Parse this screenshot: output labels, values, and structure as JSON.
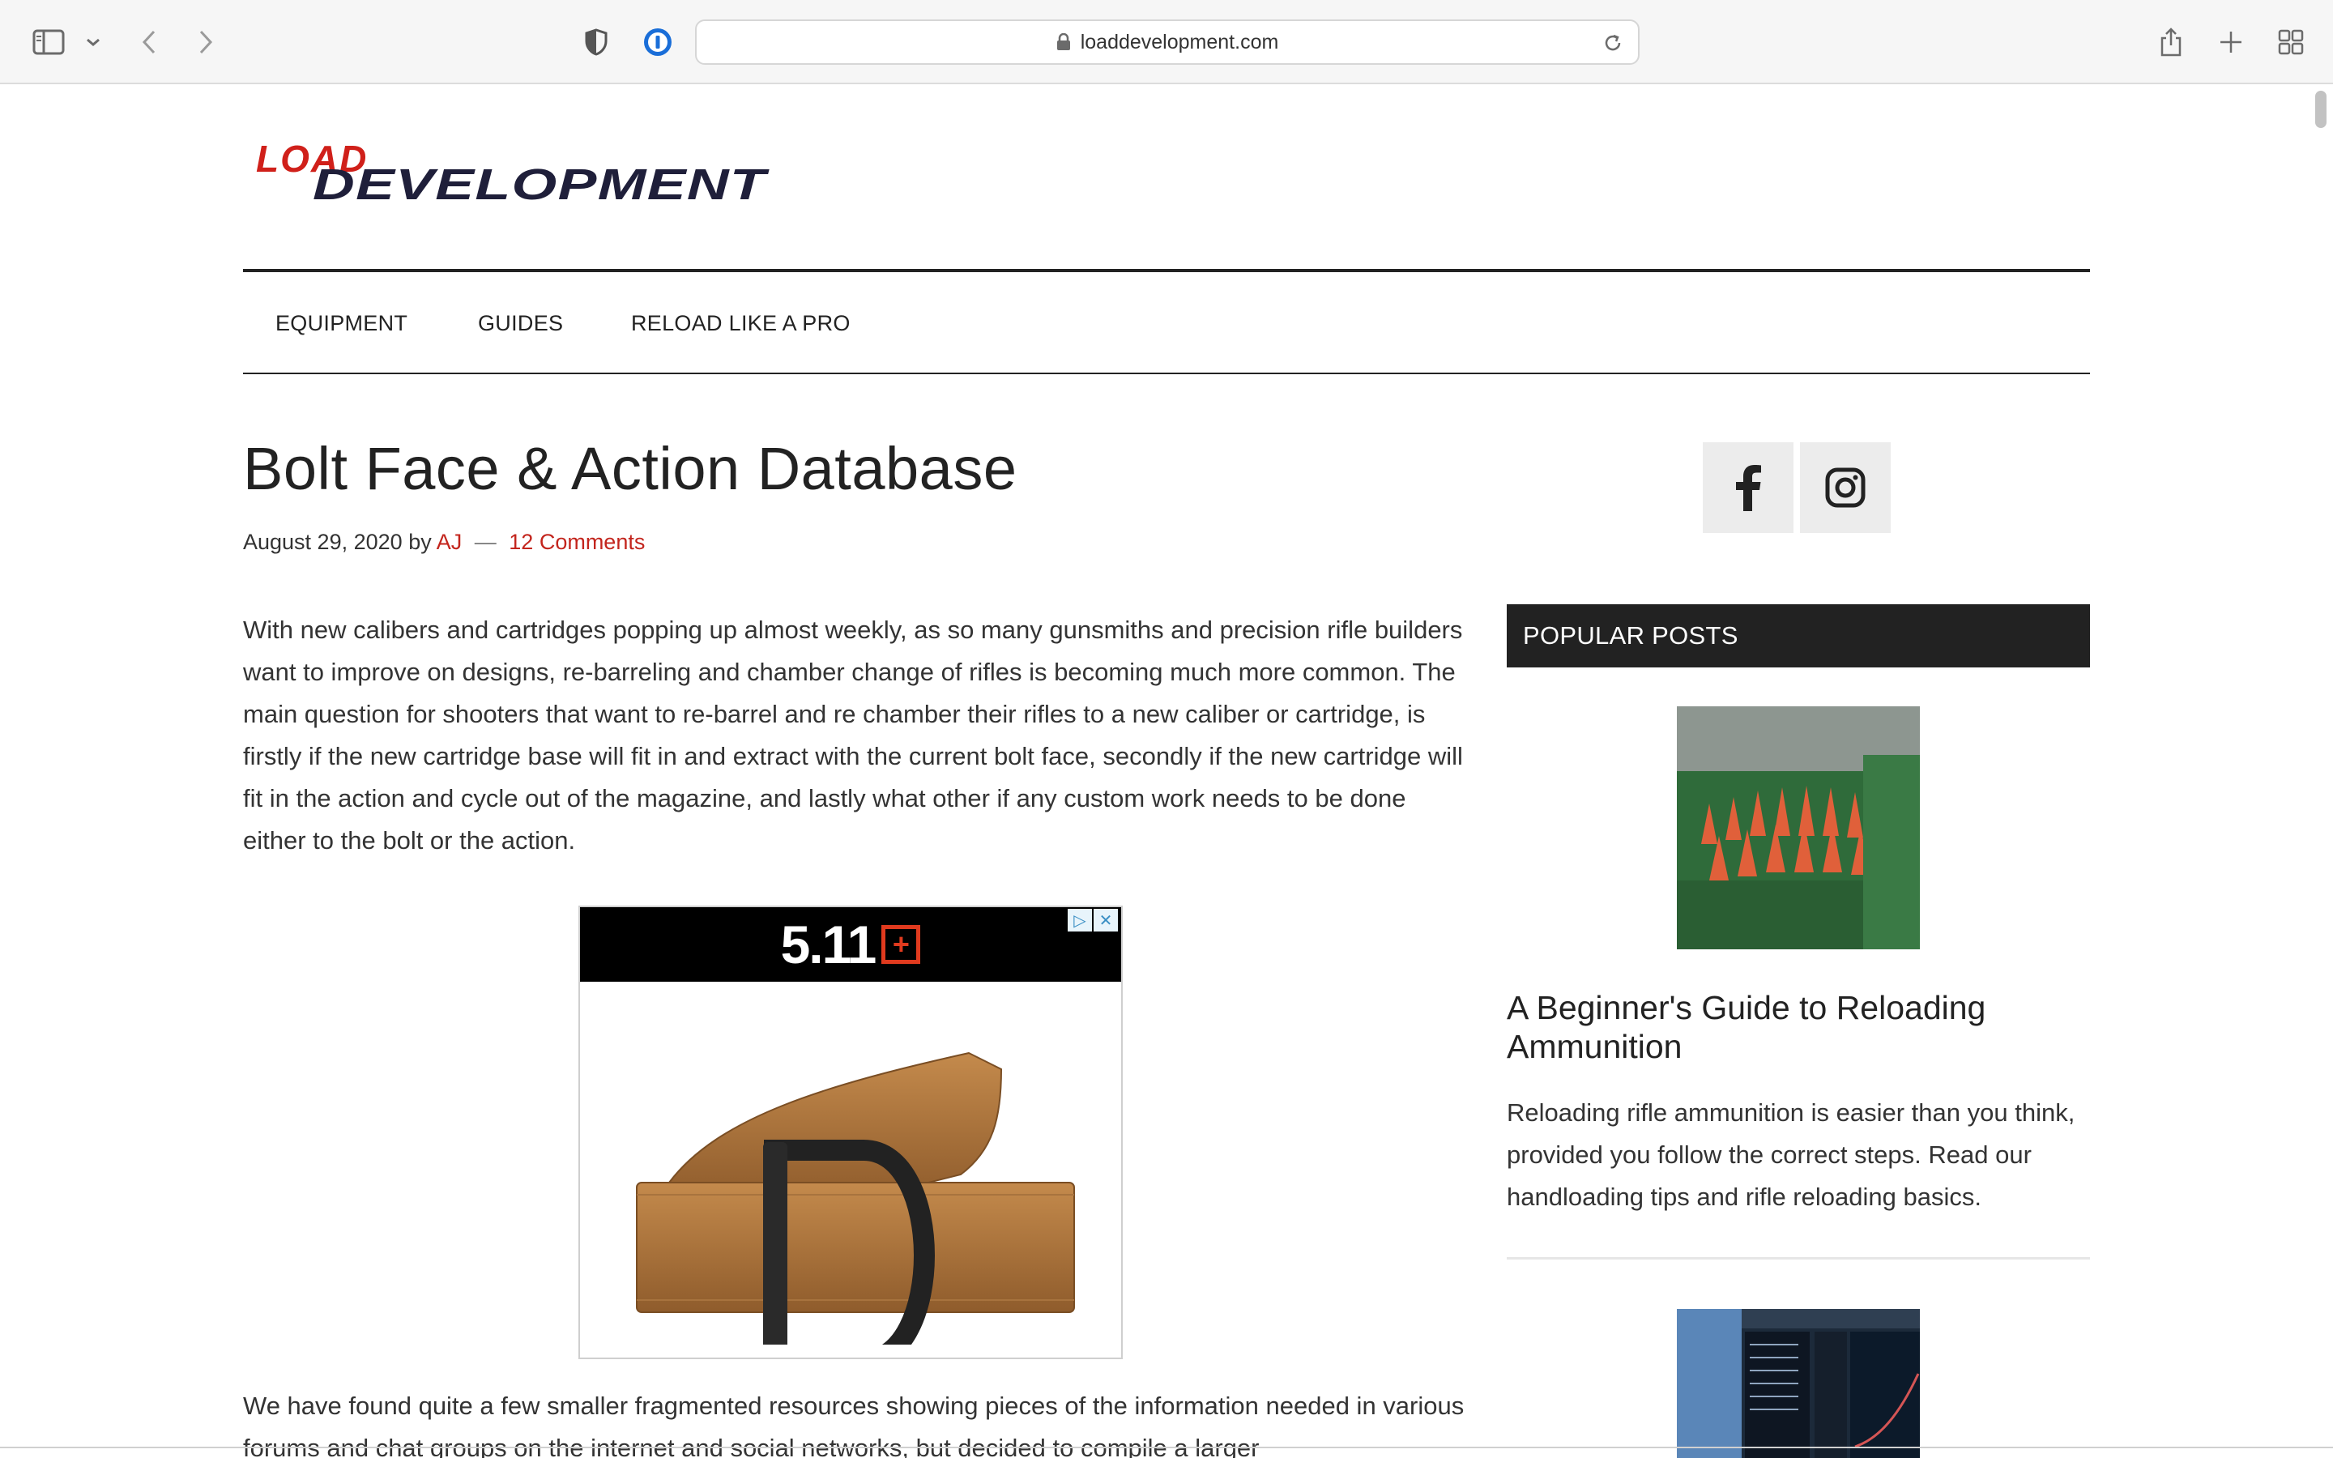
{
  "browser": {
    "url": "loaddevelopment.com",
    "icons": [
      "sidebar-icon",
      "chevron-down-icon",
      "back-arrow-icon",
      "forward-arrow-icon",
      "privacy-shield-icon",
      "password-manager-icon",
      "lock-icon",
      "reload-icon",
      "share-icon",
      "plus-icon",
      "tab-overview-icon"
    ]
  },
  "site": {
    "logo_top": "LOAD",
    "logo_bottom": "DEVELOPMENT",
    "colors": {
      "accent_red": "#c3251d",
      "dark": "#222222"
    }
  },
  "nav": {
    "items": [
      "EQUIPMENT",
      "GUIDES",
      "RELOAD LIKE A PRO"
    ]
  },
  "article": {
    "title": "Bolt Face & Action Database",
    "date": "August 29, 2020",
    "by": "by",
    "author": "AJ",
    "separator": "—",
    "comments": "12 Comments",
    "paragraph1": "With new calibers and cartridges popping up almost weekly, as so many gunsmiths and precision rifle builders want to improve on designs, re-barreling and chamber change of rifles is becoming much more common. The main question for shooters that want to re-barrel and re chamber their rifles to a new caliber or cartridge, is firstly if the new cartridge base will fit in and extract with the current bolt face, secondly if the new cartridge will fit in the action and cycle out of the magazine, and lastly what other if any custom work needs to be done either to the bolt or the action.",
    "paragraph2": "We have found quite a few smaller fragmented resources showing pieces of the information needed in various forums and chat groups on the internet and social networks, but decided to compile a larger"
  },
  "ad": {
    "brand": "5.11",
    "brand_mark": "+",
    "choices_icons": [
      "ad-choices-icon",
      "close-icon"
    ]
  },
  "sidebar": {
    "social_icons": [
      "facebook-icon",
      "instagram-icon"
    ],
    "widget_title": "POPULAR POSTS",
    "posts": [
      {
        "title": "A Beginner's Guide to Reloading Ammunition",
        "excerpt": "Reloading rifle ammunition is easier than you think, provided you follow the correct steps. Read our handloading tips and rifle reloading basics."
      }
    ]
  }
}
